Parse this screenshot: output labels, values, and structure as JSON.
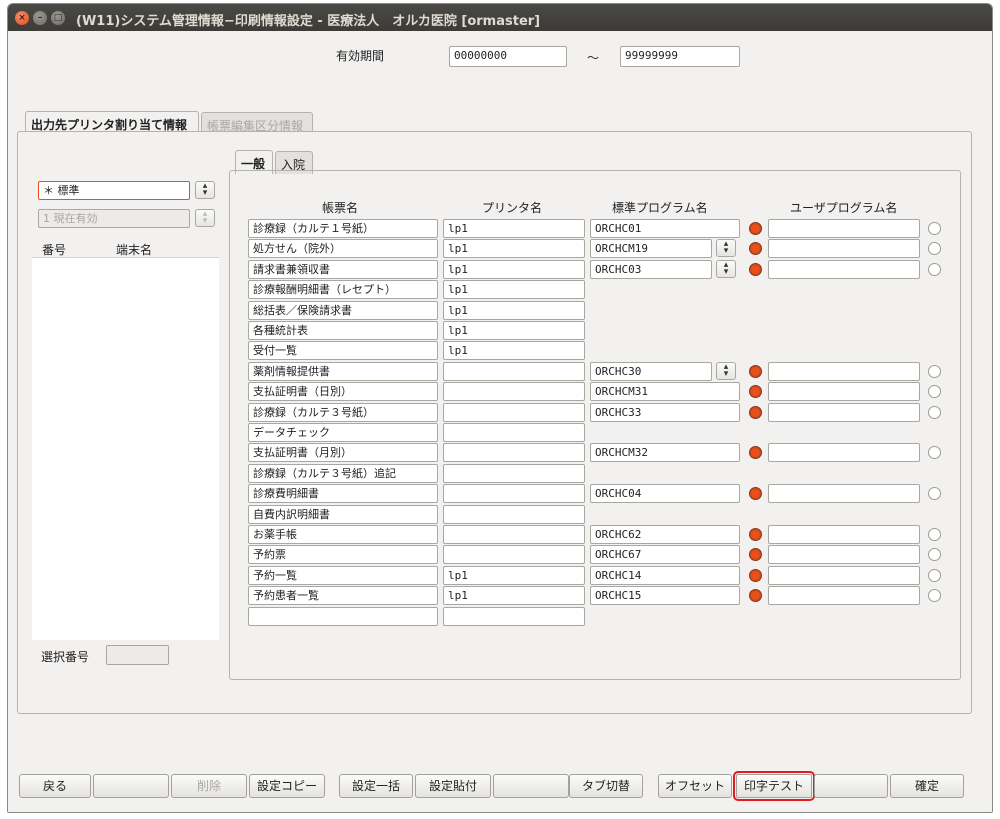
{
  "window": {
    "title": "(W11)システム管理情報−印刷情報設定 - 医療法人　オルカ医院 [ormaster]"
  },
  "validity": {
    "label": "有効期間",
    "from": "00000000",
    "separator": "～",
    "to": "99999999"
  },
  "outer_tabs": [
    {
      "label": "出力先プリンタ割り当て情報",
      "active": true
    },
    {
      "label": "帳票編集区分情報",
      "active": false
    }
  ],
  "inner_tabs": [
    {
      "label": "一般",
      "active": true
    },
    {
      "label": "入院",
      "active": false
    }
  ],
  "left_panel": {
    "combo1": "＊ 標準",
    "combo2": "1 現在有効",
    "list_headers": [
      "番号",
      "端末名"
    ],
    "select_label": "選択番号",
    "select_value": ""
  },
  "table": {
    "headers": {
      "form": "帳票名",
      "printer": "プリンタ名",
      "standard": "標準プログラム名",
      "user": "ユーザプログラム名"
    },
    "rows": [
      {
        "form": "診療録（カルテ１号紙）",
        "printer": "lp1",
        "standard": "ORCHC01",
        "spin": false,
        "radio": true
      },
      {
        "form": "処方せん（院外）",
        "printer": "lp1",
        "standard": "ORCHCM19",
        "spin": true,
        "radio": true
      },
      {
        "form": "請求書兼領収書",
        "printer": "lp1",
        "standard": "ORCHC03",
        "spin": true,
        "radio": true
      },
      {
        "form": "診療報酬明細書（レセプト）",
        "printer": "lp1",
        "standard": null,
        "spin": false,
        "radio": false
      },
      {
        "form": "総括表／保険請求書",
        "printer": "lp1",
        "standard": null,
        "spin": false,
        "radio": false
      },
      {
        "form": "各種統計表",
        "printer": "lp1",
        "standard": null,
        "spin": false,
        "radio": false
      },
      {
        "form": "受付一覧",
        "printer": "lp1",
        "standard": null,
        "spin": false,
        "radio": false
      },
      {
        "form": "薬剤情報提供書",
        "printer": "",
        "standard": "ORCHC30",
        "spin": true,
        "radio": true
      },
      {
        "form": "支払証明書（日別）",
        "printer": "",
        "standard": "ORCHCM31",
        "spin": false,
        "radio": true
      },
      {
        "form": "診療録（カルテ３号紙）",
        "printer": "",
        "standard": "ORCHC33",
        "spin": false,
        "radio": true
      },
      {
        "form": "データチェック",
        "printer": "",
        "standard": null,
        "spin": false,
        "radio": false
      },
      {
        "form": "支払証明書（月別）",
        "printer": "",
        "standard": "ORCHCM32",
        "spin": false,
        "radio": true
      },
      {
        "form": "診療録（カルテ３号紙）追記",
        "printer": "",
        "standard": null,
        "spin": false,
        "radio": false
      },
      {
        "form": "診療費明細書",
        "printer": "",
        "standard": "ORCHC04",
        "spin": false,
        "radio": true
      },
      {
        "form": "自費内訳明細書",
        "printer": "",
        "standard": null,
        "spin": false,
        "radio": false
      },
      {
        "form": "お薬手帳",
        "printer": "",
        "standard": "ORCHC62",
        "spin": false,
        "radio": true
      },
      {
        "form": "予約票",
        "printer": "",
        "standard": "ORCHC67",
        "spin": false,
        "radio": true
      },
      {
        "form": "予約一覧",
        "printer": "lp1",
        "standard": "ORCHC14",
        "spin": false,
        "radio": true
      },
      {
        "form": "予約患者一覧",
        "printer": "lp1",
        "standard": "ORCHC15",
        "spin": false,
        "radio": true
      },
      {
        "form": "",
        "printer": "",
        "standard": null,
        "spin": false,
        "radio": false
      }
    ]
  },
  "buttons": [
    {
      "label": "戻る",
      "state": "normal"
    },
    {
      "label": "",
      "state": "normal"
    },
    {
      "label": "削除",
      "state": "disabled"
    },
    {
      "label": "設定コピー",
      "state": "normal"
    },
    {
      "label": "設定一括",
      "state": "normal"
    },
    {
      "label": "設定貼付",
      "state": "normal"
    },
    {
      "label": "",
      "state": "normal"
    },
    {
      "label": "タブ切替",
      "state": "normal"
    },
    {
      "label": "オフセット",
      "state": "normal"
    },
    {
      "label": "印字テスト",
      "state": "highlighted"
    },
    {
      "label": "",
      "state": "normal"
    },
    {
      "label": "確定",
      "state": "normal"
    }
  ],
  "colors": {
    "highlight": "#e21d1d",
    "radio_selected": "#e8501d",
    "combo_focus": "#e8501d"
  }
}
